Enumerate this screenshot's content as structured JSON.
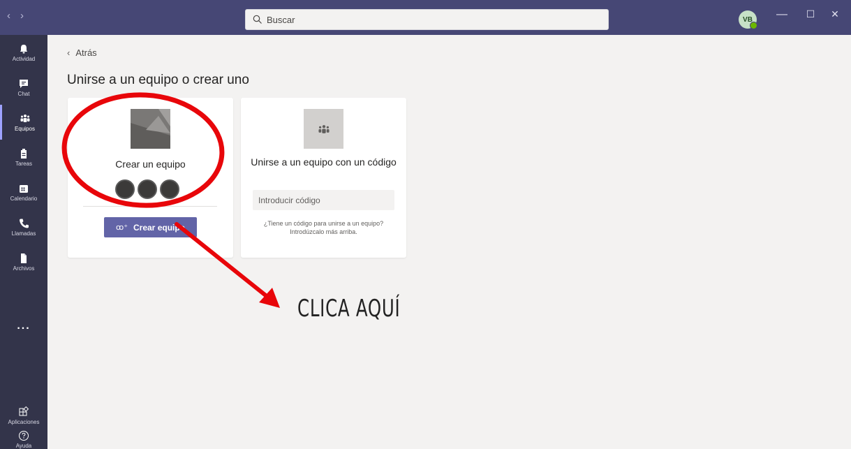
{
  "titlebar": {
    "back_arrow": "‹",
    "forward_arrow": "›",
    "search_placeholder": "Buscar",
    "avatar_initials": "VB",
    "minimize": "—",
    "maximize": "☐",
    "close": "✕"
  },
  "rail": {
    "items": [
      {
        "label": "Actividad",
        "icon": "bell-icon"
      },
      {
        "label": "Chat",
        "icon": "chat-icon"
      },
      {
        "label": "Equipos",
        "icon": "teams-icon",
        "active": true
      },
      {
        "label": "Tareas",
        "icon": "assignments-icon"
      },
      {
        "label": "Calendario",
        "icon": "calendar-icon"
      },
      {
        "label": "Llamadas",
        "icon": "phone-icon"
      },
      {
        "label": "Archivos",
        "icon": "files-icon"
      }
    ],
    "more": "...",
    "bottom": [
      {
        "label": "Aplicaciones",
        "icon": "apps-icon"
      },
      {
        "label": "Ayuda",
        "icon": "help-icon"
      }
    ]
  },
  "main": {
    "back_label": "Atrás",
    "title": "Unirse a un equipo o crear uno",
    "create_card": {
      "title": "Crear un equipo",
      "button_label": "Crear equipo"
    },
    "join_card": {
      "title": "Unirse a un equipo con un código",
      "input_placeholder": "Introducir código",
      "hint": "¿Tiene un código para unirse a un equipo? Introdúzcalo más arriba."
    }
  },
  "annotation": {
    "text": "CLICA AQUÍ",
    "color": "#e8060a"
  },
  "colors": {
    "titlebar": "#464775",
    "rail": "#33344a",
    "accent": "#6264a7",
    "background": "#f3f2f1"
  }
}
